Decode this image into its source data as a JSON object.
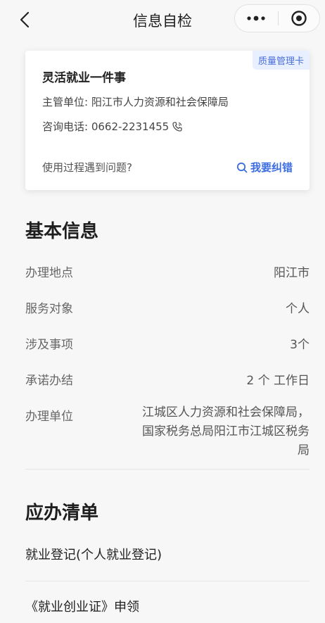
{
  "nav": {
    "title": "信息自检"
  },
  "card": {
    "badge": "质量管理卡",
    "title": "灵活就业一件事",
    "dept": "主管单位: 阳江市人力资源和社会保障局",
    "phone": "咨询电话: 0662-2231455",
    "problem": "使用过程遇到问题?",
    "correct": "我要纠错"
  },
  "basic": {
    "title": "基本信息",
    "rows": [
      {
        "label": "办理地点",
        "value": "阳江市"
      },
      {
        "label": "服务对象",
        "value": "个人"
      },
      {
        "label": "涉及事项",
        "value": "3个"
      },
      {
        "label": "承诺办结",
        "value": "2 个 工作日"
      },
      {
        "label": "办理单位",
        "value": "江城区人力资源和社会保障局，国家税务总局阳江市江城区税务局"
      }
    ]
  },
  "checklist": {
    "title": "应办清单",
    "items": [
      {
        "label": "就业登记(个人就业登记)"
      },
      {
        "label": "《就业创业证》申领"
      }
    ]
  },
  "colors": {
    "accent": "#3b6de0",
    "badge_bg": "#e8efff",
    "background": "#f7f7f7"
  }
}
